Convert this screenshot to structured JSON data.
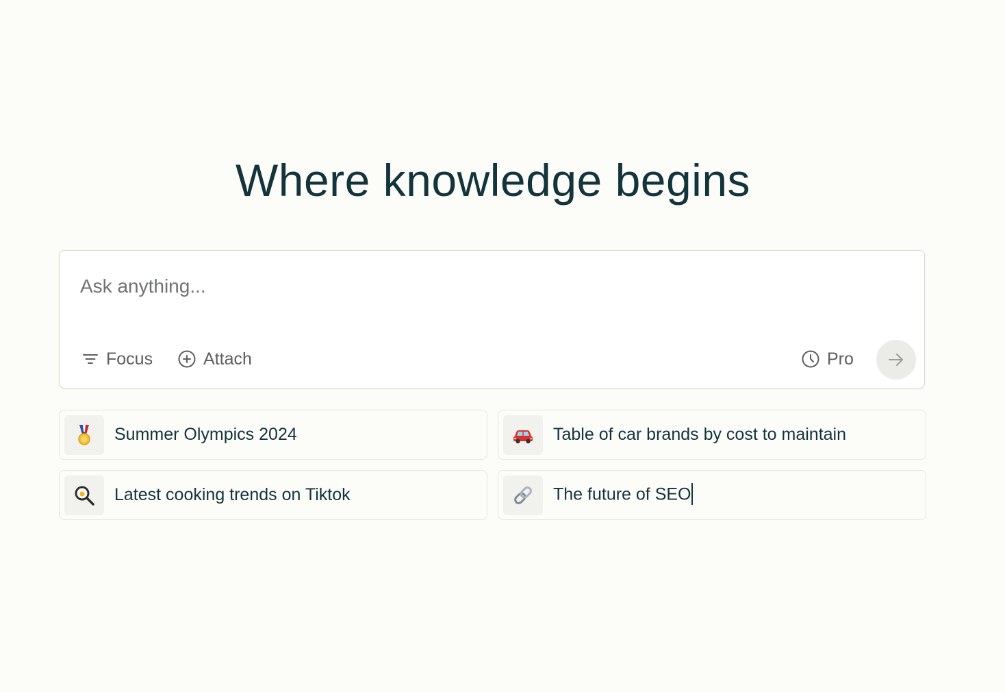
{
  "hero": {
    "title": "Where knowledge begins"
  },
  "search": {
    "placeholder": "Ask anything...",
    "value": "",
    "focus_label": "Focus",
    "attach_label": "Attach",
    "pro_label": "Pro",
    "icons": {
      "focus": "filter-lines-icon",
      "attach": "plus-circle-icon",
      "pro": "clock-icon",
      "submit": "arrow-right-icon"
    }
  },
  "suggestions": [
    {
      "label": "Summer Olympics 2024",
      "icon": "medal-icon"
    },
    {
      "label": "Table of car brands by cost to maintain",
      "icon": "car-icon"
    },
    {
      "label": "Latest cooking trends on Tiktok",
      "icon": "frying-pan-search-icon"
    },
    {
      "label": "The future of SEO",
      "icon": "link-icon"
    }
  ],
  "colors": {
    "background": "#fcfcf9",
    "text": "#13343b",
    "muted": "#5c5f5e",
    "submit_bg": "#ebebe8"
  }
}
